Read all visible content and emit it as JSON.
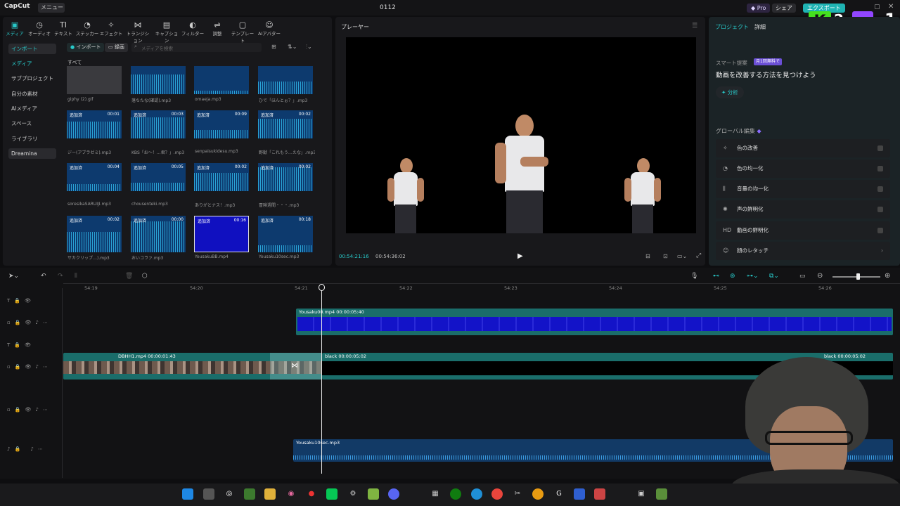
{
  "titlebar": {
    "app": "CapCut",
    "menu": "メニュー",
    "title": "0112",
    "pro": "Pro",
    "share": "シェア",
    "export": "エクスポート"
  },
  "toolbar": [
    {
      "label": "メディア",
      "icon": "media-icon"
    },
    {
      "label": "オーディオ",
      "icon": "audio-icon"
    },
    {
      "label": "テキスト",
      "icon": "text-icon"
    },
    {
      "label": "ステッカー",
      "icon": "sticker-icon"
    },
    {
      "label": "エフェクト",
      "icon": "effect-icon"
    },
    {
      "label": "トランジション",
      "icon": "transition-icon"
    },
    {
      "label": "キャプション",
      "icon": "caption-icon"
    },
    {
      "label": "フィルター",
      "icon": "filter-icon"
    },
    {
      "label": "調整",
      "icon": "adjust-icon"
    },
    {
      "label": "テンプレート",
      "icon": "template-icon"
    },
    {
      "label": "AIアバター",
      "icon": "avatar-icon"
    }
  ],
  "sidebar": [
    {
      "label": "インポート"
    },
    {
      "label": "メディア"
    },
    {
      "label": "サブプロジェクト"
    },
    {
      "label": "自分の素材"
    },
    {
      "label": "AIメディア"
    },
    {
      "label": "スペース"
    },
    {
      "label": "ライブラリ"
    },
    {
      "label": "Dreamina"
    }
  ],
  "media": {
    "import_chip": "インポート",
    "record_chip": "録画",
    "search_placeholder": "メディアを検索",
    "all_label": "すべて",
    "items": [
      {
        "name": "giphy (2).gif",
        "tag": "",
        "dur": ""
      },
      {
        "name": "落ちたな(確認).mp3",
        "tag": "",
        "dur": ""
      },
      {
        "name": "omaeja.mp3",
        "tag": "",
        "dur": ""
      },
      {
        "name": "ひで「ほんとぉ？」.mp3",
        "tag": "",
        "dur": ""
      },
      {
        "name": "ジー(アブラゼミ).mp3",
        "tag": "追加済",
        "dur": "00:01"
      },
      {
        "name": "KBS「お～！…君？」.mp3",
        "tag": "追加済",
        "dur": "00:03"
      },
      {
        "name": "senpaisukidesu.mp3",
        "tag": "追加済",
        "dur": "00:09"
      },
      {
        "name": "野獣「これもう…えな」.mp3",
        "tag": "追加済",
        "dur": "00:02"
      },
      {
        "name": "soresikaSARUIJI.mp3",
        "tag": "追加済",
        "dur": "00:04"
      },
      {
        "name": "chousenteki.mp3",
        "tag": "追加済",
        "dur": "00:05"
      },
      {
        "name": "ありがとナス！.mp3",
        "tag": "追加済",
        "dur": "00:02"
      },
      {
        "name": "冒険週間・・・.mp3",
        "tag": "追加済",
        "dur": "00:02"
      },
      {
        "name": "サカクリップ…).mp3",
        "tag": "追加済",
        "dur": "00:02"
      },
      {
        "name": "おいコラァ.mp3",
        "tag": "追加済",
        "dur": "00:00"
      },
      {
        "name": "YousakuBB.mp4",
        "tag": "追加済",
        "dur": "00:16"
      },
      {
        "name": "Yousaku10sec.mp3",
        "tag": "追加済",
        "dur": "00:18"
      }
    ]
  },
  "player": {
    "title": "プレーヤー",
    "current": "00:54:21:16",
    "total": "00:54:36:02"
  },
  "right": {
    "tab_project": "プロジェクト",
    "tab_detail": "詳細",
    "smart_label": "スマート提案",
    "free_badge": "月1回無料で",
    "improve": "動画を改善する方法を見つけよう",
    "analyze": "分析",
    "global_edit": "グローバル編集",
    "rows": [
      {
        "label": "色の改善"
      },
      {
        "label": "色の均一化"
      },
      {
        "label": "音量の均一化"
      },
      {
        "label": "声の鮮明化"
      },
      {
        "label": "動画の鮮明化"
      },
      {
        "label": "顔のレタッチ"
      }
    ]
  },
  "timeline": {
    "ruler": [
      "54:19",
      "54:20",
      "54:21",
      "54:22",
      "54:23",
      "54:24",
      "54:25",
      "54:26"
    ],
    "clip_top": "Yousaku00.mp4  00:00:05:40",
    "clip_main": "DBHH1.mp4  00:00:01:43",
    "clip_black": "black  00:00:05:02",
    "clip_black_end": "black  00:00:05:02",
    "clip_audio": "Yousaku10sec.mp3"
  },
  "overlay": {
    "k_badge": "2",
    "counter": "1"
  },
  "colors": {
    "accent": "#28c8c8",
    "clip": "#1a6d6a",
    "audio": "#123a66"
  }
}
